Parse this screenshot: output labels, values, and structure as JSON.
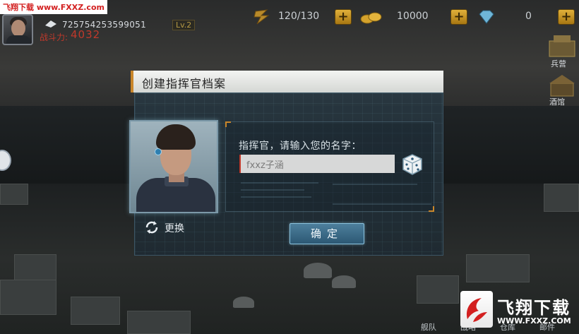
{
  "watermark": {
    "text": "飞翔下载 www.FXXZ.com"
  },
  "player": {
    "id": "725754253599051",
    "power_label": "战斗力:",
    "power_value": "4032",
    "level_badge": "Lv.2"
  },
  "resources": {
    "energy": {
      "icon": "lightning-icon",
      "value": "120/130"
    },
    "gold": {
      "icon": "coins-icon",
      "value": "10000"
    },
    "diamond": {
      "icon": "diamond-icon",
      "value": "0"
    }
  },
  "side_menu": {
    "item1_label": "兵营",
    "item2_label": "酒馆"
  },
  "dialog": {
    "title": "创建指挥官档案",
    "prompt": "指挥官，请输入您的名字：",
    "name_value": "fxxz子涵",
    "change_label": "更换",
    "confirm_label": "确定"
  },
  "bottom_nav": {
    "items": [
      "舰队",
      "战略",
      "仓库",
      "邮件"
    ]
  },
  "logo_watermark": {
    "title": "飞翔下载",
    "url": "WWW.FXXZ.COM"
  },
  "colors": {
    "accent_orange": "#c9862a",
    "power_red": "#c0392b",
    "button_blue": "#2c5874",
    "gold_plus": "#e0b03a"
  }
}
